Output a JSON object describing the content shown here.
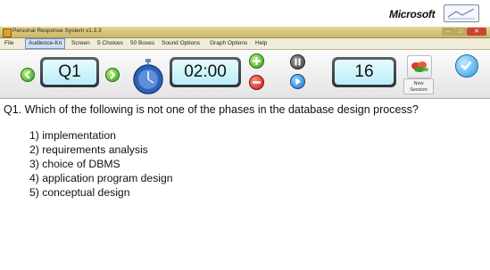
{
  "brand": {
    "name": "Microsoft"
  },
  "window": {
    "title": "Personal Response System v1.3.3"
  },
  "menu": {
    "items": [
      "File",
      "Audience-Kn",
      "Screen",
      "5 Choices",
      "50 Boxes",
      "Sound Options",
      "Graph Options",
      "Help"
    ],
    "active": "Audience-Kn"
  },
  "toolbar": {
    "question_number": "Q1",
    "timer": "02:00",
    "responses_count": "16",
    "new_session_label": "New\nSession",
    "icons": {
      "prev": "green-left-arrow-icon",
      "next": "green-right-arrow-icon",
      "stopwatch": "stopwatch-icon",
      "plus": "plus-icon",
      "minus": "minus-icon",
      "pause": "pause-icon",
      "play": "play-icon",
      "new_session": "flowers-icon",
      "confirm": "checkmark-icon"
    }
  },
  "content": {
    "question": "Q1. Which of the following is not one of the phases in the database design process?",
    "answers": [
      "1) implementation",
      "2) requirements analysis",
      "3) choice of DBMS",
      "4) application program design",
      "5) conceptual design"
    ]
  },
  "colors": {
    "lcd_background": "#c9f3fa",
    "title_bar": "#d6c67c",
    "close_button": "#c94436",
    "accent_green": "#2e9e1f",
    "accent_red": "#c61d12",
    "accent_blue": "#1b74c9"
  }
}
